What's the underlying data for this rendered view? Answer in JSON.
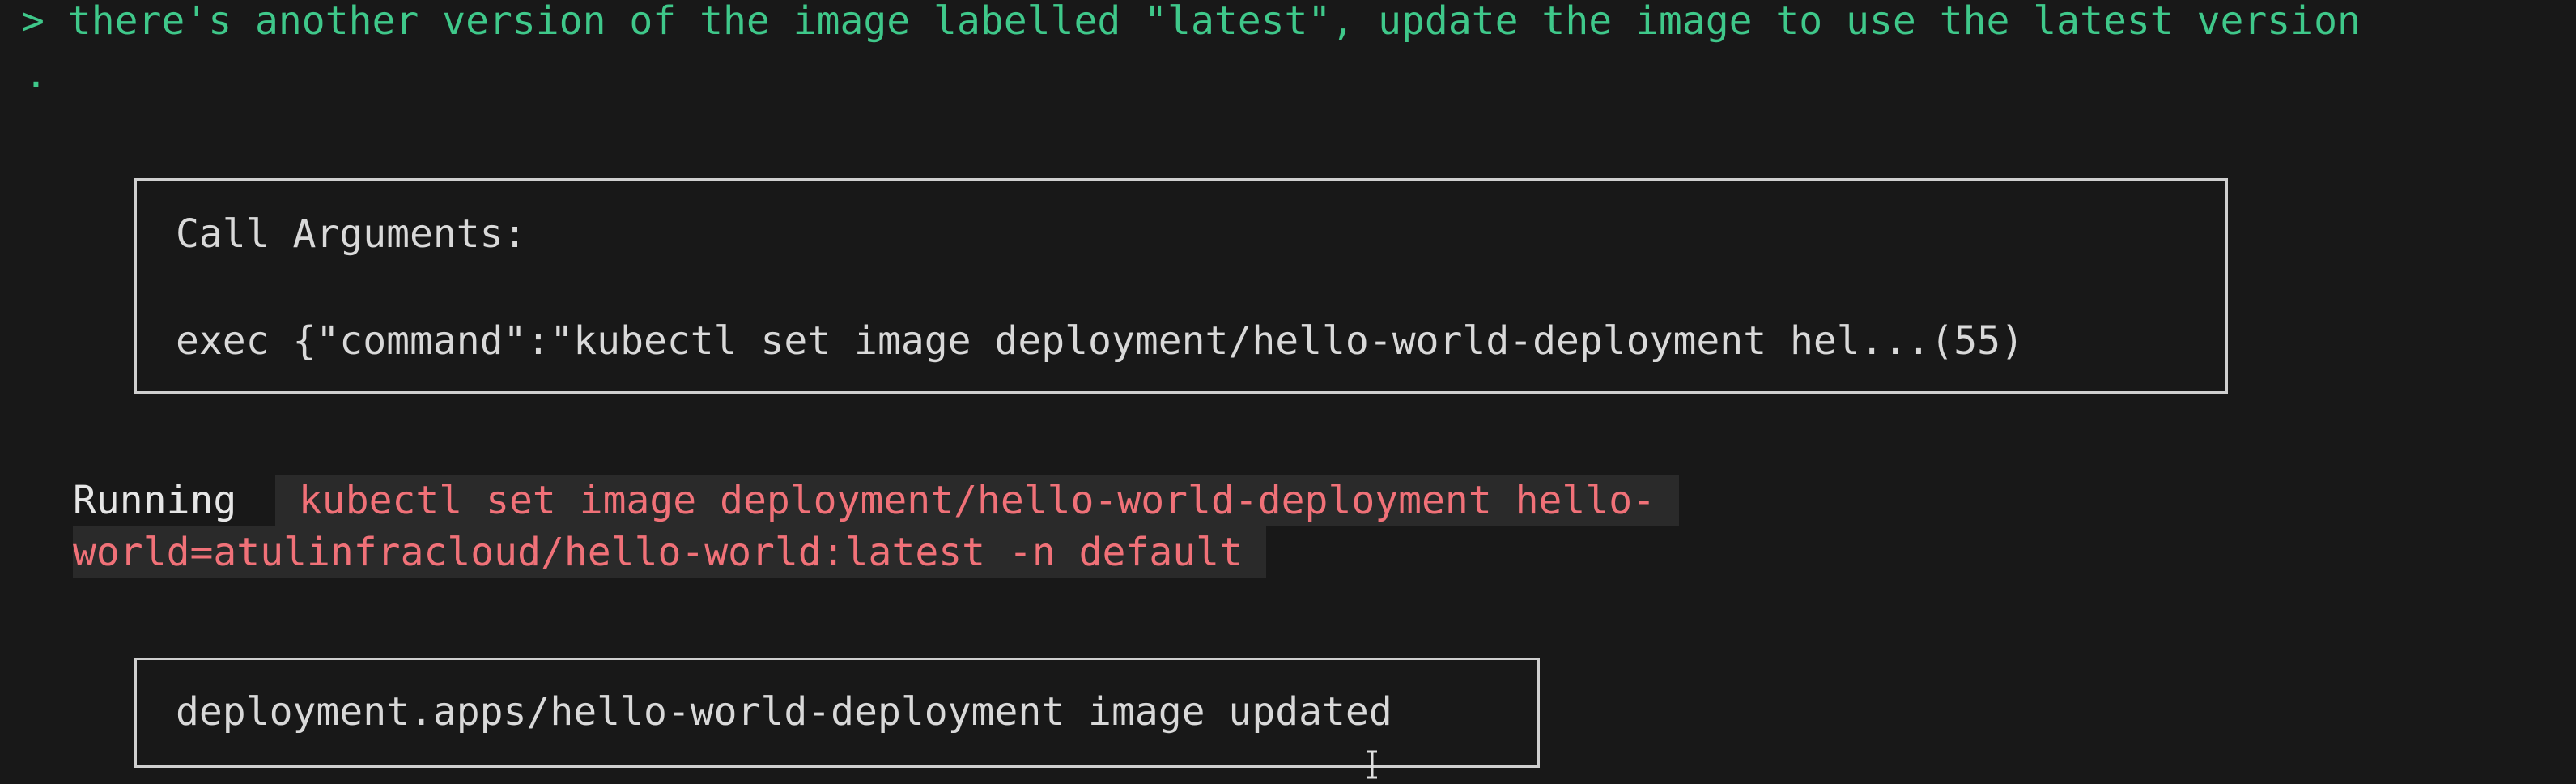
{
  "prompt": {
    "symbol": ">",
    "text": "there's another version of the image labelled \"latest\", update the image to use the latest version",
    "continuation": "."
  },
  "call_box": {
    "title": "Call Arguments:",
    "args": "exec {\"command\":\"kubectl set image deployment/hello-world-deployment hel...(55)"
  },
  "running": {
    "label": "Running",
    "command_line1": "kubectl set image deployment/hello-world-deployment hello-",
    "command_line2": "world=atulinfracloud/hello-world:latest -n default"
  },
  "result_box": {
    "output": "deployment.apps/hello-world-deployment image updated"
  },
  "colors": {
    "background": "#181818",
    "prompt": "#3fc88a",
    "command": "#f07178",
    "command_bg": "#2a2a2a",
    "text": "#d7d7d7"
  },
  "icons": {
    "cursor": "text-cursor-icon"
  }
}
